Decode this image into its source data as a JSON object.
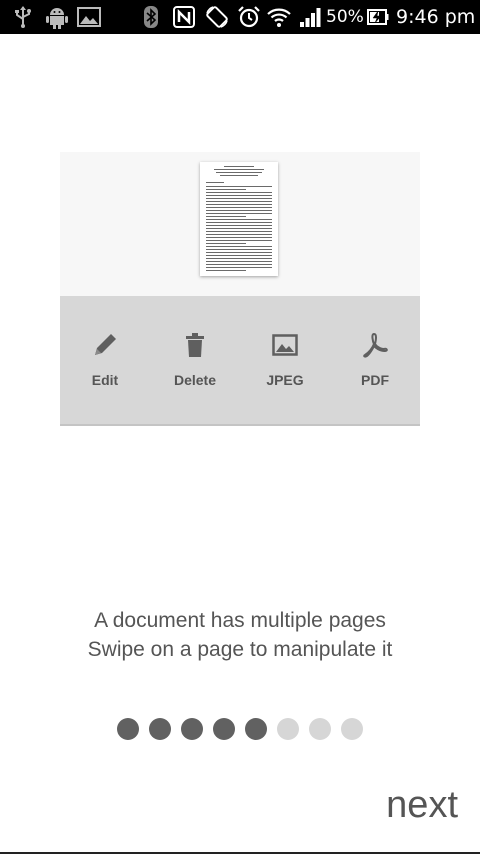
{
  "status_bar": {
    "battery_percent": "50%",
    "time": "9:46 pm",
    "icons": [
      "usb-icon",
      "android-debug-icon",
      "image-icon",
      "bluetooth-icon",
      "nfc-icon",
      "screen-rotation-icon",
      "alarm-icon",
      "wifi-icon",
      "signal-icon",
      "battery-charging-icon"
    ]
  },
  "illustration": {
    "tools": [
      {
        "label": "Edit",
        "icon": "pencil-icon"
      },
      {
        "label": "Delete",
        "icon": "trash-icon"
      },
      {
        "label": "JPEG",
        "icon": "image-icon"
      },
      {
        "label": "PDF",
        "icon": "pdf-icon"
      }
    ]
  },
  "caption": {
    "line1": "A document has multiple pages",
    "line2": "Swipe on a page to manipulate it"
  },
  "pager": {
    "total": 8,
    "active_count": 5,
    "active_color": "#616161",
    "inactive_color": "#d6d6d6"
  },
  "next_label": "next",
  "colors": {
    "status_bar_bg": "#000000",
    "toolbar_bg": "#d7d7d7",
    "text": "#555555"
  }
}
